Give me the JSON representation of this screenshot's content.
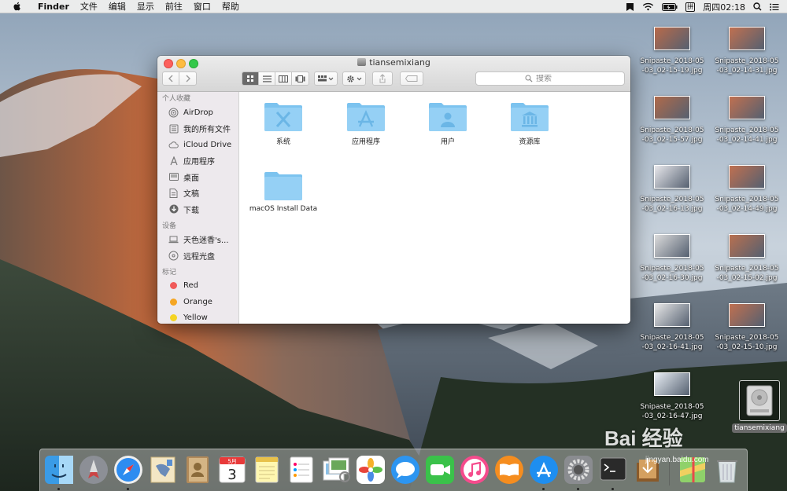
{
  "menubar": {
    "app_name": "Finder",
    "items": [
      "文件",
      "编辑",
      "显示",
      "前往",
      "窗口",
      "帮助"
    ],
    "ime_label": "拼",
    "clock": "周四02:18"
  },
  "window": {
    "title": "tiansemixiang",
    "search_placeholder": "搜索"
  },
  "sidebar": {
    "favorites_header": "个人收藏",
    "favorites": [
      {
        "label": "AirDrop",
        "icon": "airdrop-icon"
      },
      {
        "label": "我的所有文件",
        "icon": "all-files-icon"
      },
      {
        "label": "iCloud Drive",
        "icon": "cloud-icon"
      },
      {
        "label": "应用程序",
        "icon": "applications-icon"
      },
      {
        "label": "桌面",
        "icon": "desktop-icon"
      },
      {
        "label": "文稿",
        "icon": "documents-icon"
      },
      {
        "label": "下载",
        "icon": "downloads-icon"
      }
    ],
    "devices_header": "设备",
    "devices": [
      {
        "label": "天色迷香's...",
        "icon": "laptop-icon"
      },
      {
        "label": "远程光盘",
        "icon": "disc-icon"
      }
    ],
    "tags_header": "标记",
    "tags": [
      {
        "label": "Red",
        "color": "#f05a5a"
      },
      {
        "label": "Orange",
        "color": "#f5a623"
      },
      {
        "label": "Yellow",
        "color": "#f5d423"
      }
    ]
  },
  "folders": [
    {
      "label": "系统",
      "glyph": "X"
    },
    {
      "label": "应用程序",
      "glyph": "A"
    },
    {
      "label": "用户",
      "glyph": "user"
    },
    {
      "label": "资源库",
      "glyph": "library"
    },
    {
      "label": "macOS Install Data",
      "glyph": ""
    }
  ],
  "desktop_icons": [
    {
      "label_line1": "Snipaste_2018-05",
      "label_line2": "-03_02-15-19.jpg"
    },
    {
      "label_line1": "Snipaste_2018-05",
      "label_line2": "-03_02-14-31.jpg"
    },
    {
      "label_line1": "Snipaste_2018-05",
      "label_line2": "-03_02-15-57.jpg"
    },
    {
      "label_line1": "Snipaste_2018-05",
      "label_line2": "-03_02-14-41.jpg"
    },
    {
      "label_line1": "Snipaste_2018-05",
      "label_line2": "-03_02-16-13.jpg"
    },
    {
      "label_line1": "Snipaste_2018-05",
      "label_line2": "-03_02-14-49.jpg"
    },
    {
      "label_line1": "Snipaste_2018-05",
      "label_line2": "-03_02-16-30.jpg"
    },
    {
      "label_line1": "Snipaste_2018-05",
      "label_line2": "-03_02-15-02.jpg"
    },
    {
      "label_line1": "Snipaste_2018-05",
      "label_line2": "-03_02-16-41.jpg"
    },
    {
      "label_line1": "Snipaste_2018-05",
      "label_line2": "-03_02-15-10.jpg"
    },
    {
      "label_line1": "Snipaste_2018-05",
      "label_line2": "-03_02-16-47.jpg"
    }
  ],
  "hdd_label": "tiansemixiang",
  "dock": {
    "apps": [
      "finder-icon",
      "launchpad-icon",
      "safari-icon",
      "mail-icon",
      "contacts-icon",
      "calendar-icon",
      "notes-icon",
      "reminders-icon",
      "preview-icon",
      "photos-icon",
      "messages-icon",
      "facetime-icon",
      "itunes-icon",
      "ibooks-icon",
      "app-store-icon",
      "system-preferences-icon",
      "terminal-icon",
      "downloads-stack-icon",
      "maps-icon",
      "trash-icon"
    ],
    "calendar_month": "5月",
    "calendar_day": "3"
  },
  "watermark": {
    "text": "Bai 经验",
    "sub": "jingyan.baidu.com"
  }
}
